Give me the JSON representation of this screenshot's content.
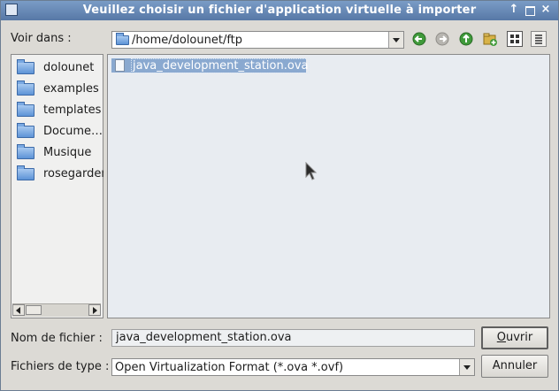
{
  "window": {
    "title": "Veuillez choisir un fichier d'application virtuelle à importer",
    "controls": [
      "↑",
      "×"
    ]
  },
  "look_in": {
    "label": "Voir dans :",
    "path": "/home/dolounet/ftp"
  },
  "nav_icons": [
    "back-icon",
    "forward-icon",
    "up-icon",
    "new-folder-icon",
    "list-view-icon",
    "detail-view-icon"
  ],
  "sidebar": {
    "items": [
      {
        "label": "dolounet"
      },
      {
        "label": "examples"
      },
      {
        "label": "templates"
      },
      {
        "label": "Docume…"
      },
      {
        "label": "Musique"
      },
      {
        "label": "rosegarden"
      }
    ]
  },
  "files": [
    {
      "name": "java_development_station.ova"
    }
  ],
  "filename": {
    "label": "Nom de fichier :",
    "value": "java_development_station.ova"
  },
  "filetype": {
    "label": "Fichiers de type :",
    "value": "Open Virtualization Format (*.ova *.ovf)"
  },
  "buttons": {
    "open_first": "O",
    "open_rest": "uvrir",
    "cancel": "Annuler"
  },
  "colors": {
    "titlebar": "#5778a6",
    "selection": "#8aa9d0",
    "nav_green": "#3f9a3a"
  }
}
